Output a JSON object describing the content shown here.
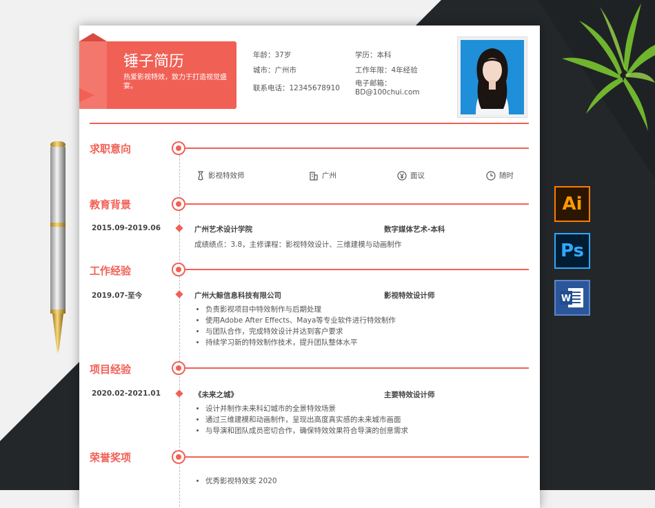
{
  "resume": {
    "name": "锤子简历",
    "tagline": "热爱影视特效，致力于打造视觉盛宴。",
    "info": {
      "age": "年龄：37岁",
      "education": "学历：本科",
      "city": "城市：广州市",
      "years": "工作年限：4年经验",
      "phone": "联系电话：12345678910",
      "email_label": "电子邮箱：",
      "email": "BD@100chui.com"
    }
  },
  "sections": {
    "intent": {
      "title": "求职意向",
      "position": "影视特效师",
      "city": "广州",
      "salary": "面议",
      "availability": "随时"
    },
    "education": {
      "title": "教育背景",
      "date": "2015.09-2019.06",
      "school": "广州艺术设计学院",
      "major": "数字媒体艺术-本科",
      "detail": "成绩绩点：3.8，主修课程：影视特效设计、三维建模与动画制作"
    },
    "work": {
      "title": "工作经验",
      "date": "2019.07-至今",
      "company": "广州大鲸信息科技有限公司",
      "role": "影视特效设计师",
      "items": [
        "负责影视项目中特效制作与后期处理",
        "使用Adobe After Effects、Maya等专业软件进行特效制作",
        "与团队合作，完成特效设计并达到客户要求",
        "持续学习新的特效制作技术，提升团队整体水平"
      ]
    },
    "project": {
      "title": "项目经验",
      "date": "2020.02-2021.01",
      "name": "《未来之城》",
      "role": "主要特效设计师",
      "items": [
        "设计并制作未来科幻城市的全景特效场景",
        "通过三维建模和动画制作，呈现出高度真实感的未来城市画面",
        "与导演和团队成员密切合作，确保特效效果符合导演的创意需求"
      ]
    },
    "honors": {
      "title": "荣誉奖项",
      "items": [
        "优秀影视特效奖 2020"
      ]
    }
  },
  "side_icons": {
    "ai": "Ai",
    "ps": "Ps"
  },
  "colors": {
    "accent": "#f16055",
    "background_dark": "#23272a"
  }
}
